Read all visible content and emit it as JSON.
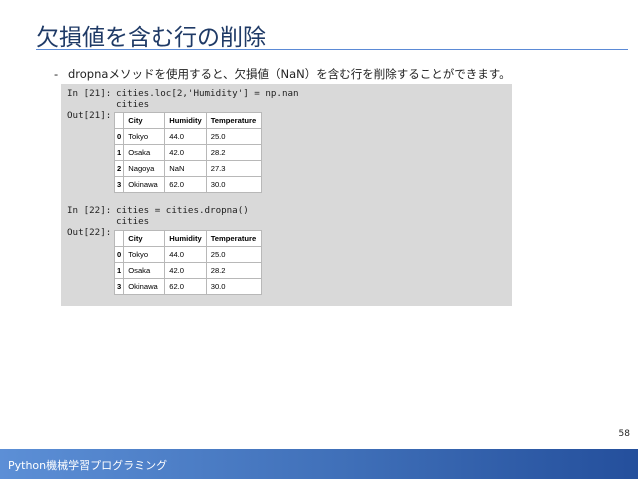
{
  "slide": {
    "title": "欠損値を含む行の削除",
    "bullet_dash": "-",
    "bullet": "dropnaメソッドを使用すると、欠損値（NaN）を含む行を削除することができます。",
    "page_number": "58",
    "footer": "Python機械学習プログラミング",
    "colors": {
      "title": "#1f3a66",
      "rule": "#5b8ad6",
      "panel": "#d9d9d9",
      "footer_start": "#5c8fd6",
      "footer_end": "#244f9c"
    }
  },
  "cell1": {
    "in_prompt": "In [21]:",
    "line1": "cities.loc[2,'Humidity'] = np.nan",
    "line2": "cities",
    "out_prompt": "Out[21]:",
    "table": {
      "headers": [
        "",
        "City",
        "Humidity",
        "Temperature"
      ],
      "rows": [
        [
          "0",
          "Tokyo",
          "44.0",
          "25.0"
        ],
        [
          "1",
          "Osaka",
          "42.0",
          "28.2"
        ],
        [
          "2",
          "Nagoya",
          "NaN",
          "27.3"
        ],
        [
          "3",
          "Okinawa",
          "62.0",
          "30.0"
        ]
      ]
    }
  },
  "cell2": {
    "in_prompt": "In [22]:",
    "line1": "cities = cities.dropna()",
    "line2": "cities",
    "out_prompt": "Out[22]:",
    "table": {
      "headers": [
        "",
        "City",
        "Humidity",
        "Temperature"
      ],
      "rows": [
        [
          "0",
          "Tokyo",
          "44.0",
          "25.0"
        ],
        [
          "1",
          "Osaka",
          "42.0",
          "28.2"
        ],
        [
          "3",
          "Okinawa",
          "62.0",
          "30.0"
        ]
      ]
    }
  }
}
